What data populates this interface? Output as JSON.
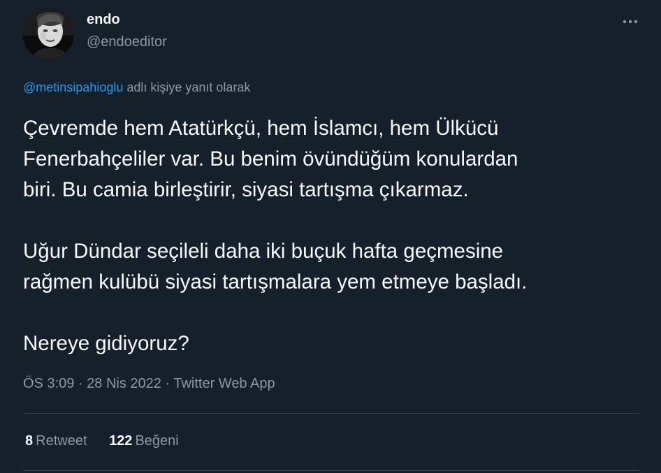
{
  "author": {
    "display_name": "endo",
    "handle": "@endoeditor",
    "avatar_icon": "profile-photo"
  },
  "more_icon": "more-horizontal-icon",
  "reply": {
    "mention": "@metinsipahioglu",
    "suffix": " adlı kişiye yanıt olarak"
  },
  "tweet": {
    "paragraphs": [
      "Çevremde hem Atatürkçü, hem İslamcı, hem Ülkücü\nFenerbahçeliler var. Bu benim övündüğüm konulardan\nbiri. Bu camia birleştirir, siyasi tartışma çıkarmaz.",
      "Uğur Dündar seçileli daha iki buçuk hafta geçmesine\nrağmen kulübü siyasi tartışmalara yem etmeye başladı.",
      "Nereye gidiyoruz?"
    ]
  },
  "meta": {
    "time": "ÖS 3:09",
    "separator1": " · ",
    "date": "28 Nis 2022",
    "separator2": " · ",
    "source": "Twitter Web App"
  },
  "stats": {
    "retweets_count": "8",
    "retweets_label": "Retweet",
    "likes_count": "122",
    "likes_label": "Beğeni"
  },
  "colors": {
    "background": "#15202b",
    "text_primary": "#f7f9f9",
    "text_secondary": "#8b98a5",
    "link": "#1d9bf0",
    "divider": "#38444d"
  }
}
